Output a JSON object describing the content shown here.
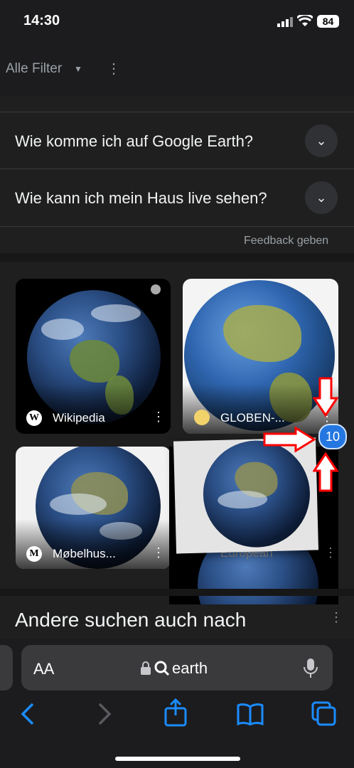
{
  "status": {
    "time": "14:30",
    "battery": "84"
  },
  "filters": {
    "label": "Alle Filter"
  },
  "faq": {
    "questions": [
      "Wie komme ich auf Google Earth?",
      "Wie kann ich mein Haus live sehen?"
    ],
    "feedback": "Feedback geben"
  },
  "images": [
    {
      "source": "Wikipedia",
      "icon_letter": "W"
    },
    {
      "source": "GLOBEN-...",
      "icon_letter": ""
    },
    {
      "source": "Møbelhus...",
      "icon_letter": "M"
    },
    {
      "source": "European",
      "icon_letter": ""
    }
  ],
  "badge": {
    "count": "10"
  },
  "others": {
    "title": "Andere suchen auch nach"
  },
  "browser": {
    "aa_label": "AA",
    "url": "earth"
  },
  "colors": {
    "accent": "#1a8cff",
    "arrow": "#ff0000",
    "badge": "#2477e0"
  }
}
